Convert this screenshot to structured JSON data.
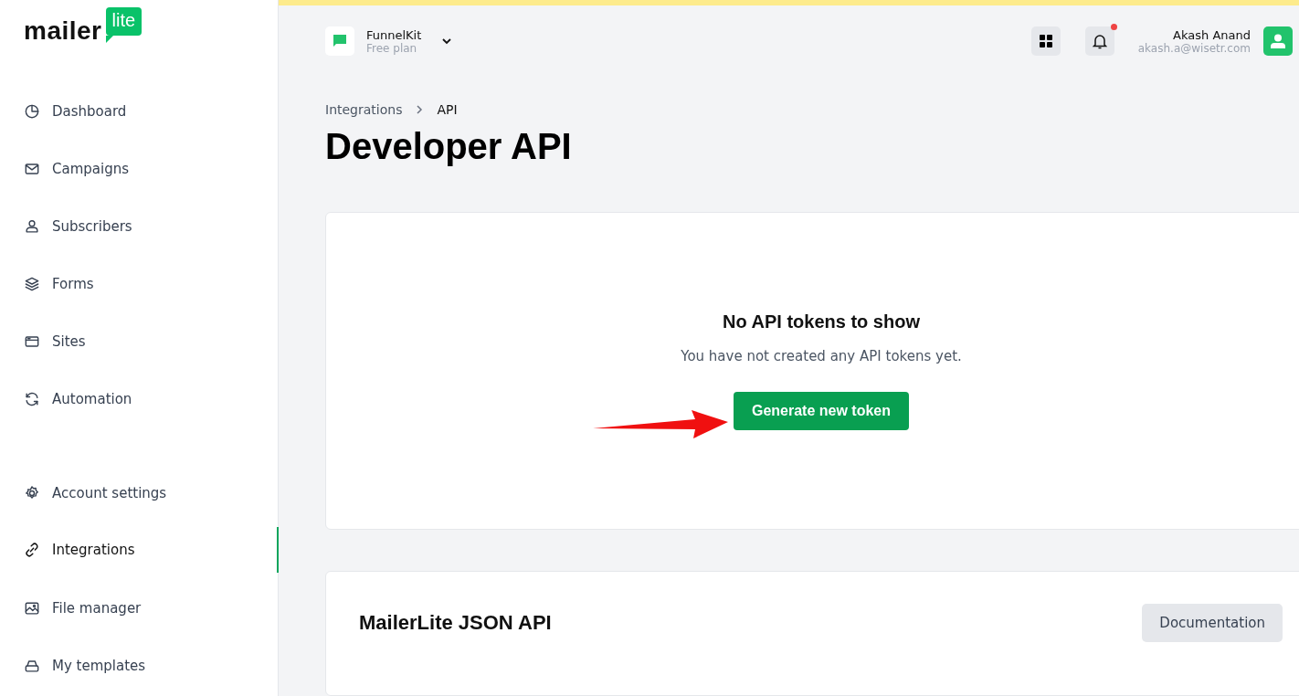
{
  "logo": {
    "word": "mailer",
    "badge": "lite"
  },
  "sidebar": {
    "groups": [
      {
        "items": [
          {
            "label": "Dashboard",
            "selected": false
          },
          {
            "label": "Campaigns",
            "selected": false
          },
          {
            "label": "Subscribers",
            "selected": false
          },
          {
            "label": "Forms",
            "selected": false
          },
          {
            "label": "Sites",
            "selected": false
          },
          {
            "label": "Automation",
            "selected": false
          }
        ]
      },
      {
        "items": [
          {
            "label": "Account settings",
            "selected": false
          },
          {
            "label": "Integrations",
            "selected": true
          },
          {
            "label": "File manager",
            "selected": false
          },
          {
            "label": "My templates",
            "selected": false
          }
        ]
      }
    ]
  },
  "account_switcher": {
    "name": "FunnelKit",
    "plan": "Free plan"
  },
  "notifications": {
    "unread": true
  },
  "user": {
    "name": "Akash Anand",
    "email": "akash.a@wisetr.com"
  },
  "breadcrumb": [
    "Integrations",
    "API"
  ],
  "page_title": "Developer API",
  "tokens_card": {
    "title": "No API tokens to show",
    "message": "You have not created any API tokens yet.",
    "button": "Generate new token"
  },
  "json_api_card": {
    "title": "MailerLite JSON API",
    "button": "Documentation"
  }
}
